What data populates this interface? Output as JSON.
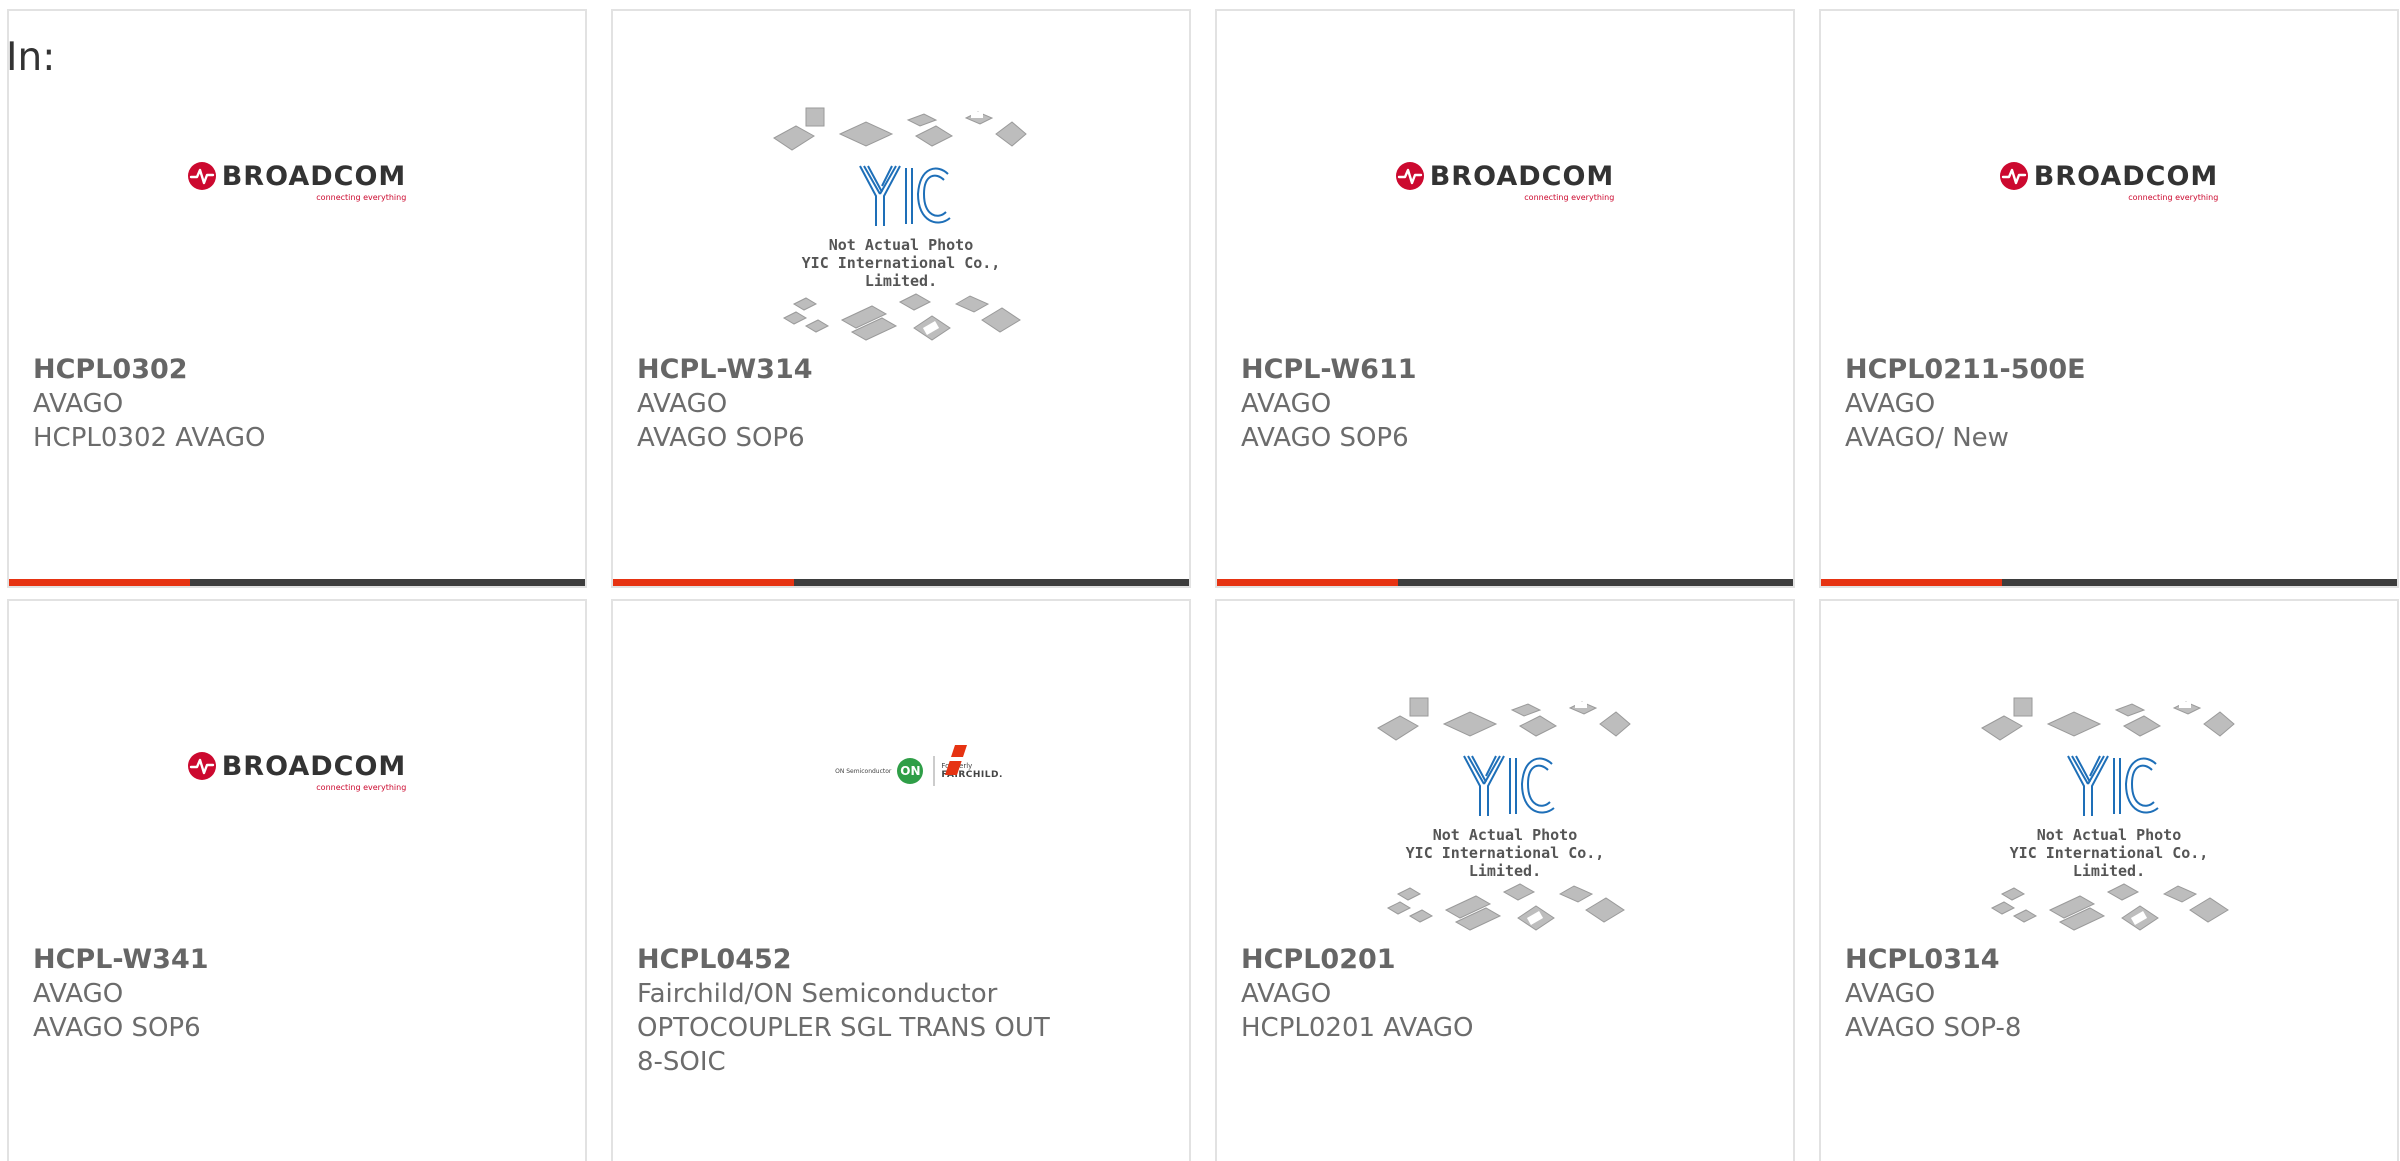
{
  "header": {
    "in_label": "In:"
  },
  "colors": {
    "accent": "#e63312",
    "bar_dark": "#3d3d3d",
    "broadcom_red": "#cc092f",
    "on_green": "#2f9e47",
    "yic_blue": "#1e6fb8"
  },
  "logos": {
    "broadcom": {
      "word": "BROADCOM",
      "tagline": "connecting everything"
    },
    "yic": {
      "line1": "Not Actual Photo",
      "line2": "YIC International Co., Limited."
    },
    "on_fairchild": {
      "on_text": "ON Semiconductor",
      "on_mark": "ON",
      "formerly": "Formerly",
      "fairchild": "FAIRCHILD."
    }
  },
  "products": [
    {
      "part": "HCPL0302",
      "brand": "AVAGO",
      "desc": "HCPL0302 AVAGO",
      "image": "broadcom"
    },
    {
      "part": "HCPL-W314",
      "brand": "AVAGO",
      "desc": "AVAGO SOP6",
      "image": "yic"
    },
    {
      "part": "HCPL-W611",
      "brand": "AVAGO",
      "desc": "AVAGO SOP6",
      "image": "broadcom"
    },
    {
      "part": "HCPL0211-500E",
      "brand": "AVAGO",
      "desc": "AVAGO/ New",
      "image": "broadcom"
    },
    {
      "part": "HCPL-W341",
      "brand": "AVAGO",
      "desc": "AVAGO SOP6",
      "image": "broadcom"
    },
    {
      "part": "HCPL0452",
      "brand": "Fairchild/ON Semiconductor",
      "desc": "OPTOCOUPLER SGL TRANS OUT 8-SOIC",
      "image": "on_fairchild"
    },
    {
      "part": "HCPL0201",
      "brand": "AVAGO",
      "desc": "HCPL0201 AVAGO",
      "image": "yic"
    },
    {
      "part": "HCPL0314",
      "brand": "AVAGO",
      "desc": "AVAGO SOP-8",
      "image": "yic"
    }
  ]
}
